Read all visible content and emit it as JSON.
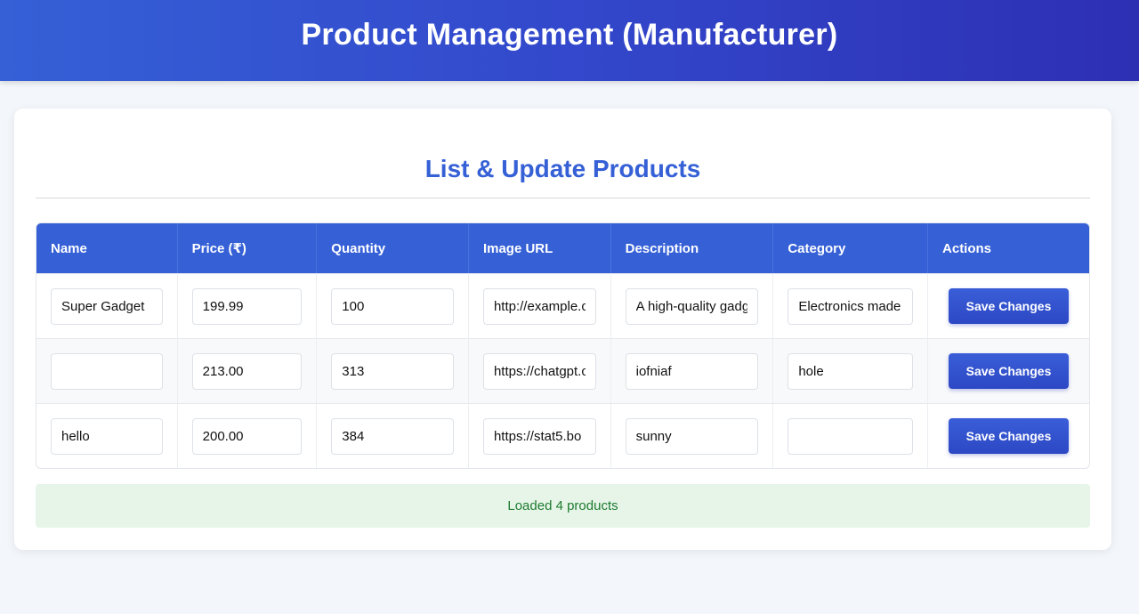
{
  "header": {
    "title": "Product Management (Manufacturer)"
  },
  "section": {
    "title": "List & Update Products"
  },
  "table": {
    "columns": [
      "Name",
      "Price (₹)",
      "Quantity",
      "Image URL",
      "Description",
      "Category",
      "Actions"
    ],
    "rows": [
      {
        "name": "Super Gadget",
        "price": "199.99",
        "quantity": "100",
        "image_url": "http://example.com/gadget.jpg",
        "description": "A high-quality gadget",
        "category": "Electronics made",
        "action": "Save Changes"
      },
      {
        "name": "",
        "price": "213.00",
        "quantity": "313",
        "image_url": "https://chatgpt.com",
        "description": "iofniaf",
        "category": "hole",
        "action": "Save Changes"
      },
      {
        "name": "hello",
        "price": "200.00",
        "quantity": "384",
        "image_url": "https://stat5.bo",
        "description": "sunny",
        "category": "",
        "action": "Save Changes"
      }
    ]
  },
  "status": {
    "message": "Loaded 4 products"
  },
  "colors": {
    "accent": "#3560d6",
    "success_bg": "#e6f5e8",
    "success_text": "#1e7b30"
  }
}
